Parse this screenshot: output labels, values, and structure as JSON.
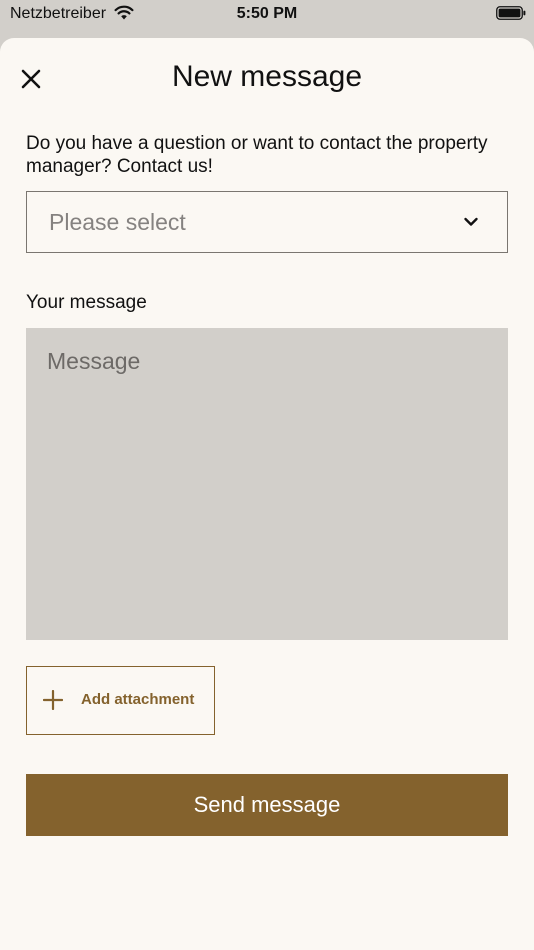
{
  "status_bar": {
    "carrier": "Netzbetreiber",
    "time": "5:50 PM",
    "wifi_icon": "wifi-icon",
    "battery_icon": "battery-icon"
  },
  "sheet": {
    "title": "New message",
    "close_icon": "close-icon"
  },
  "form": {
    "intro": "Do you have a question or want to contact the property manager? Contact us!",
    "topic_select": {
      "placeholder": "Please select",
      "icon": "chevron-down-icon"
    },
    "message_label": "Your message",
    "message_placeholder": "Message",
    "message_value": "",
    "attachment": {
      "label": "Add attachment",
      "icon": "plus-icon"
    },
    "send_label": "Send message"
  },
  "colors": {
    "accent": "#84622d",
    "background": "#fbf8f3",
    "field_background": "#d2cfca",
    "status_bar_background": "#d2cfca"
  }
}
